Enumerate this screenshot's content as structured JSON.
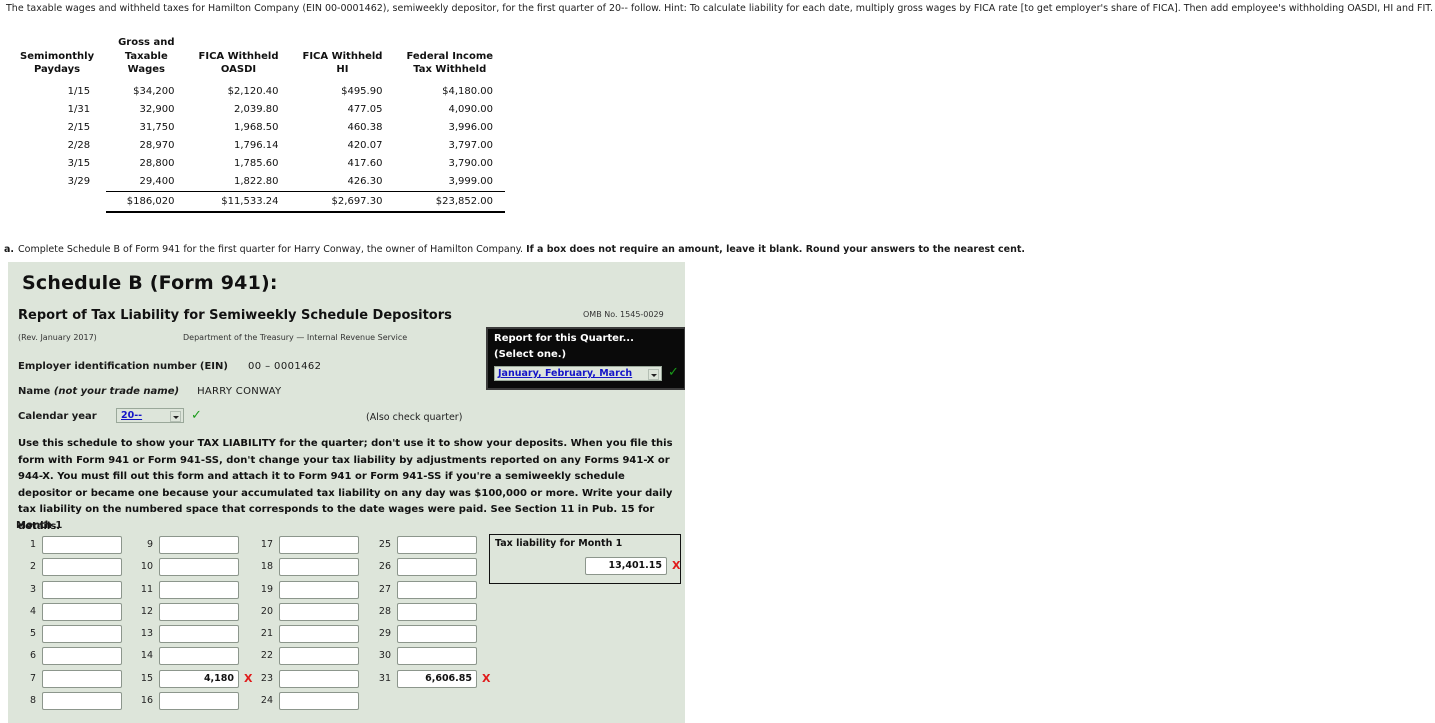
{
  "intro": "The taxable wages and withheld taxes for Hamilton Company (EIN 00-0001462), semiweekly depositor, for the first quarter of 20-- follow. Hint: To calculate liability for each date, multiply gross wages by FICA rate [to get employer's share of FICA]. Then add employee's withholding OASDI, HI and FIT.",
  "wage_table": {
    "headers": [
      "Semimonthly\nPaydays",
      "Gross and\nTaxable\nWages",
      "FICA Withheld\nOASDI",
      "FICA Withheld\nHI",
      "Federal Income\nTax Withheld"
    ],
    "rows": [
      [
        "1/15",
        "$34,200",
        "$2,120.40",
        "$495.90",
        "$4,180.00"
      ],
      [
        "1/31",
        "32,900",
        "2,039.80",
        "477.05",
        "4,090.00"
      ],
      [
        "2/15",
        "31,750",
        "1,968.50",
        "460.38",
        "3,996.00"
      ],
      [
        "2/28",
        "28,970",
        "1,796.14",
        "420.07",
        "3,797.00"
      ],
      [
        "3/15",
        "28,800",
        "1,785.60",
        "417.60",
        "3,790.00"
      ],
      [
        "3/29",
        "29,400",
        "1,822.80",
        "426.30",
        "3,999.00"
      ]
    ],
    "totals": [
      "",
      "$186,020",
      "$11,533.24",
      "$2,697.30",
      "$23,852.00"
    ]
  },
  "part_a": {
    "label": "a.",
    "text_normal": "Complete Schedule B of Form 941 for the first quarter for Harry Conway, the owner of Hamilton Company.",
    "text_bold": "If a box does not require an amount, leave it blank. Round your answers to the nearest cent."
  },
  "form": {
    "title": "Schedule B (Form 941):",
    "subtitle": "Report of Tax Liability for Semiweekly Schedule Depositors",
    "omb": "OMB No. 1545-0029",
    "revision": "(Rev. January 2017)",
    "department": "Department of the Treasury — Internal Revenue Service",
    "ein_label": "Employer identification number (EIN)",
    "ein_value": "00 – 0001462",
    "name_label_bold": "Name",
    "name_label_italic": "(not your trade name)",
    "name_value": "HARRY CONWAY",
    "calendar_year_label": "Calendar year",
    "calendar_year_value": "20--",
    "also_check_quarter": "(Also check quarter)",
    "quarter_box": {
      "line1": "Report for this Quarter...",
      "line2": "(Select one.)",
      "selected": "January, February, March"
    },
    "instructions": "Use this schedule to show your TAX LIABILITY for the quarter; don't use it to show your deposits. When you file this form with Form 941 or Form 941-SS, don't change your tax liability by adjustments reported on any Forms 941-X or 944-X. You must fill out this form and attach it to Form 941 or Form 941-SS if you're a semiweekly schedule depositor or became one because your accumulated tax liability on any day was $100,000 or more. Write your daily tax liability on the numbered space that corresponds to the date wages were paid. See Section 11 in Pub. 15 for details.",
    "month_label": "Month 1",
    "day_columns": [
      [
        {
          "n": "1",
          "value": "",
          "mark": ""
        },
        {
          "n": "2",
          "value": "",
          "mark": ""
        },
        {
          "n": "3",
          "value": "",
          "mark": ""
        },
        {
          "n": "4",
          "value": "",
          "mark": ""
        },
        {
          "n": "5",
          "value": "",
          "mark": ""
        },
        {
          "n": "6",
          "value": "",
          "mark": ""
        },
        {
          "n": "7",
          "value": "",
          "mark": ""
        },
        {
          "n": "8",
          "value": "",
          "mark": ""
        }
      ],
      [
        {
          "n": "9",
          "value": "",
          "mark": ""
        },
        {
          "n": "10",
          "value": "",
          "mark": ""
        },
        {
          "n": "11",
          "value": "",
          "mark": ""
        },
        {
          "n": "12",
          "value": "",
          "mark": ""
        },
        {
          "n": "13",
          "value": "",
          "mark": ""
        },
        {
          "n": "14",
          "value": "",
          "mark": ""
        },
        {
          "n": "15",
          "value": "4,180",
          "mark": "X"
        },
        {
          "n": "16",
          "value": "",
          "mark": ""
        }
      ],
      [
        {
          "n": "17",
          "value": "",
          "mark": ""
        },
        {
          "n": "18",
          "value": "",
          "mark": ""
        },
        {
          "n": "19",
          "value": "",
          "mark": ""
        },
        {
          "n": "20",
          "value": "",
          "mark": ""
        },
        {
          "n": "21",
          "value": "",
          "mark": ""
        },
        {
          "n": "22",
          "value": "",
          "mark": ""
        },
        {
          "n": "23",
          "value": "",
          "mark": ""
        },
        {
          "n": "24",
          "value": "",
          "mark": ""
        }
      ],
      [
        {
          "n": "25",
          "value": "",
          "mark": ""
        },
        {
          "n": "26",
          "value": "",
          "mark": ""
        },
        {
          "n": "27",
          "value": "",
          "mark": ""
        },
        {
          "n": "28",
          "value": "",
          "mark": ""
        },
        {
          "n": "29",
          "value": "",
          "mark": ""
        },
        {
          "n": "30",
          "value": "",
          "mark": ""
        },
        {
          "n": "31",
          "value": "6,606.85",
          "mark": "X"
        }
      ]
    ],
    "liability_box": {
      "caption": "Tax liability for Month 1",
      "value": "13,401.15",
      "mark": "X"
    },
    "colors": {
      "panel_bg": "#dde5da",
      "link": "#1414c8",
      "tick": "#1a9b1a",
      "error": "#e01b1b",
      "quarter_box_bg": "#0a0a0a"
    }
  }
}
